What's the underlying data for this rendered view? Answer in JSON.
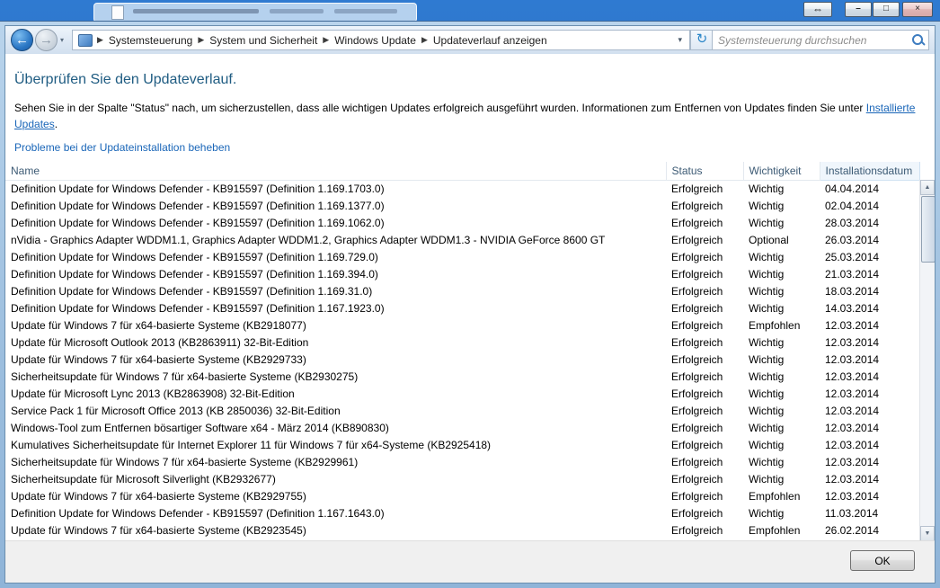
{
  "icons": {
    "window_switch": "⇔",
    "minimize": "–",
    "maximize": "□",
    "close": "×",
    "back": "←",
    "forward": "→",
    "dropdown": "▾",
    "separator": "▶",
    "refresh": "↻",
    "scroll_up": "▲",
    "scroll_down": "▼"
  },
  "navbar": {
    "breadcrumb": [
      "Systemsteuerung",
      "System und Sicherheit",
      "Windows Update",
      "Updateverlauf anzeigen"
    ],
    "search_placeholder": "Systemsteuerung durchsuchen"
  },
  "content": {
    "title": "Überprüfen Sie den Updateverlauf.",
    "intro_before": "Sehen Sie in der Spalte \"Status\" nach, um sicherzustellen, dass alle wichtigen Updates erfolgreich ausgeführt wurden. Informationen zum Entfernen von Updates finden Sie unter ",
    "intro_link": "Installierte Updates",
    "intro_after": ".",
    "troubleshoot_link": "Probleme bei der Updateinstallation beheben"
  },
  "table": {
    "columns": [
      "Name",
      "Status",
      "Wichtigkeit",
      "Installationsdatum"
    ],
    "rows": [
      {
        "name": "Definition Update for Windows Defender - KB915597 (Definition 1.169.1703.0)",
        "status": "Erfolgreich",
        "importance": "Wichtig",
        "date": "04.04.2014"
      },
      {
        "name": "Definition Update for Windows Defender - KB915597 (Definition 1.169.1377.0)",
        "status": "Erfolgreich",
        "importance": "Wichtig",
        "date": "02.04.2014"
      },
      {
        "name": "Definition Update for Windows Defender - KB915597 (Definition 1.169.1062.0)",
        "status": "Erfolgreich",
        "importance": "Wichtig",
        "date": "28.03.2014"
      },
      {
        "name": "nVidia - Graphics Adapter WDDM1.1, Graphics Adapter WDDM1.2, Graphics Adapter WDDM1.3 - NVIDIA GeForce 8600 GT",
        "status": "Erfolgreich",
        "importance": "Optional",
        "date": "26.03.2014"
      },
      {
        "name": "Definition Update for Windows Defender - KB915597 (Definition 1.169.729.0)",
        "status": "Erfolgreich",
        "importance": "Wichtig",
        "date": "25.03.2014"
      },
      {
        "name": "Definition Update for Windows Defender - KB915597 (Definition 1.169.394.0)",
        "status": "Erfolgreich",
        "importance": "Wichtig",
        "date": "21.03.2014"
      },
      {
        "name": "Definition Update for Windows Defender - KB915597 (Definition 1.169.31.0)",
        "status": "Erfolgreich",
        "importance": "Wichtig",
        "date": "18.03.2014"
      },
      {
        "name": "Definition Update for Windows Defender - KB915597 (Definition 1.167.1923.0)",
        "status": "Erfolgreich",
        "importance": "Wichtig",
        "date": "14.03.2014"
      },
      {
        "name": "Update für Windows 7 für x64-basierte Systeme (KB2918077)",
        "status": "Erfolgreich",
        "importance": "Empfohlen",
        "date": "12.03.2014"
      },
      {
        "name": "Update für Microsoft Outlook 2013 (KB2863911) 32-Bit-Edition",
        "status": "Erfolgreich",
        "importance": "Wichtig",
        "date": "12.03.2014"
      },
      {
        "name": "Update für Windows 7 für x64-basierte Systeme (KB2929733)",
        "status": "Erfolgreich",
        "importance": "Wichtig",
        "date": "12.03.2014"
      },
      {
        "name": "Sicherheitsupdate für Windows 7 für x64-basierte Systeme (KB2930275)",
        "status": "Erfolgreich",
        "importance": "Wichtig",
        "date": "12.03.2014"
      },
      {
        "name": "Update für Microsoft Lync 2013 (KB2863908) 32-Bit-Edition",
        "status": "Erfolgreich",
        "importance": "Wichtig",
        "date": "12.03.2014"
      },
      {
        "name": "Service Pack 1 für Microsoft Office 2013 (KB 2850036) 32-Bit-Edition",
        "status": "Erfolgreich",
        "importance": "Wichtig",
        "date": "12.03.2014"
      },
      {
        "name": "Windows-Tool zum Entfernen bösartiger Software x64 - März 2014 (KB890830)",
        "status": "Erfolgreich",
        "importance": "Wichtig",
        "date": "12.03.2014"
      },
      {
        "name": "Kumulatives Sicherheitsupdate für Internet Explorer 11 für Windows 7 für x64-Systeme (KB2925418)",
        "status": "Erfolgreich",
        "importance": "Wichtig",
        "date": "12.03.2014"
      },
      {
        "name": "Sicherheitsupdate für Windows 7 für x64-basierte Systeme (KB2929961)",
        "status": "Erfolgreich",
        "importance": "Wichtig",
        "date": "12.03.2014"
      },
      {
        "name": "Sicherheitsupdate für Microsoft Silverlight (KB2932677)",
        "status": "Erfolgreich",
        "importance": "Wichtig",
        "date": "12.03.2014"
      },
      {
        "name": "Update für Windows 7 für x64-basierte Systeme (KB2929755)",
        "status": "Erfolgreich",
        "importance": "Empfohlen",
        "date": "12.03.2014"
      },
      {
        "name": "Definition Update for Windows Defender - KB915597 (Definition 1.167.1643.0)",
        "status": "Erfolgreich",
        "importance": "Wichtig",
        "date": "11.03.2014"
      },
      {
        "name": "Update für Windows 7 für x64-basierte Systeme (KB2923545)",
        "status": "Erfolgreich",
        "importance": "Empfohlen",
        "date": "26.02.2014"
      }
    ]
  },
  "footer": {
    "ok_label": "OK"
  }
}
